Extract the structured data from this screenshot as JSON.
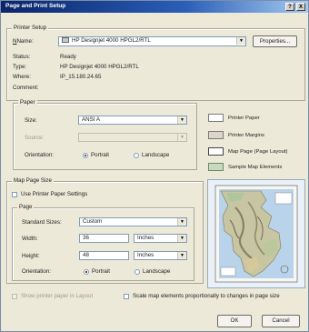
{
  "window": {
    "title": "Page and Print Setup",
    "help_btn": "?",
    "close_btn": "X"
  },
  "printer_setup": {
    "group_label": "Printer Setup",
    "name_label": "Name:",
    "name_value": "HP Designjet 4000 HPGL2/RTL",
    "properties_label": "Properties...",
    "status_label": "Status:",
    "status_value": "Ready",
    "type_label": "Type:",
    "type_value": "HP Designjet 4000 HPGL2/RTL",
    "where_label": "Where:",
    "where_value": "IP_15.180.24.65",
    "comment_label": "Comment:"
  },
  "paper": {
    "group_label": "Paper",
    "size_label": "Size:",
    "size_value": "ANSI A",
    "source_label": "Source:",
    "source_value": "",
    "orientation_label": "Orientation:",
    "portrait_label": "Portrait",
    "landscape_label": "Landscape",
    "orientation_selected": "Portrait"
  },
  "legend": {
    "printer_paper": "Printer Paper",
    "printer_margins": "Printer Margins",
    "map_page": "Map Page (Page Layout)",
    "sample_map": "Sample Map Elements"
  },
  "map_page_size": {
    "group_label": "Map Page Size",
    "use_printer_settings_label": "Use Printer Paper Settings",
    "use_printer_settings_checked": false,
    "page_group_label": "Page",
    "standard_sizes_label": "Standard Sizes:",
    "standard_sizes_value": "Custom",
    "width_label": "Width:",
    "width_value": "36",
    "width_unit": "Inches",
    "height_label": "Height:",
    "height_value": "48",
    "height_unit": "Inches",
    "orientation_label": "Orientation:",
    "portrait_label": "Portrait",
    "landscape_label": "Landscape",
    "orientation_selected": "Portrait"
  },
  "footer": {
    "show_printer_paper_label": "Show printer paper in Layout",
    "scale_elements_label": "Scale map elements proportionally to changes in page size",
    "ok_label": "OK",
    "cancel_label": "Cancel"
  },
  "colors": {
    "titlebar_start": "#0a246a",
    "titlebar_end": "#a6caf0",
    "dialog_bg": "#ece9d8"
  },
  "icons": {
    "printer": "printer-icon",
    "dropdown": "chevron-down-icon",
    "sample_map": "map-icon"
  }
}
